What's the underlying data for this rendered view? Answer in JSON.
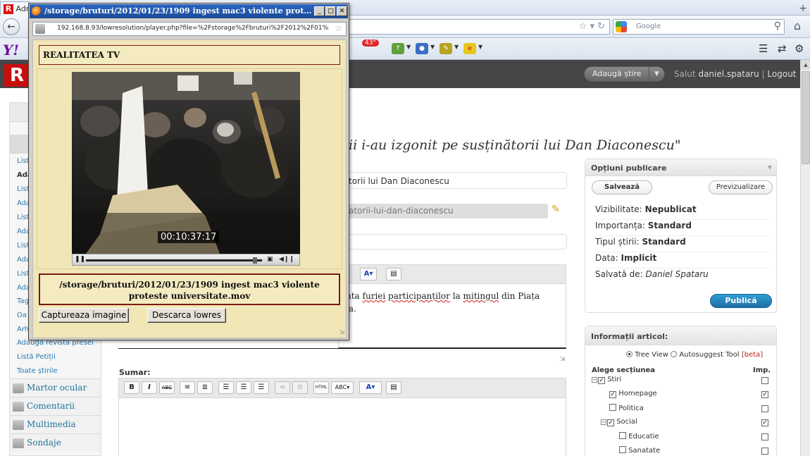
{
  "browser": {
    "tab_label": "Adm",
    "new_tab_icon": "plus-icon",
    "search_placeholder": "Google",
    "weather_badge": "43°"
  },
  "site": {
    "logo_letter": "R",
    "add_story_label": "Adaugă știre",
    "greeting_prefix": "Salut",
    "username": "daniel.spataru",
    "separator": "|",
    "logout_label": "Logout"
  },
  "sidebar": {
    "submenu": [
      "Listă",
      "Adaugă",
      "Listă",
      "Adaugă",
      "Listă",
      "Adaugă",
      "Listă",
      "Adaugă",
      "Listă",
      "Adaugă",
      "Tag",
      "Oa",
      "Arh",
      "Adaugă revista presei",
      "Listă Petiții",
      "Toate știrile"
    ],
    "groups": [
      "Martor ocular",
      "Comentarii",
      "Multimedia",
      "Sondaje"
    ]
  },
  "article": {
    "title_fragment": "ii i-au izgonit pe susținătorii lui Dan Diaconescu\"",
    "title_field_fragment": "torii lui Dan Diaconescu",
    "slug_fragment": "atorii-lui-dan-diaconescu",
    "content_line1_a": "nta ",
    "content_line1_b": "furiei",
    "content_line1_c": " ",
    "content_line1_d": "participanților",
    "content_line1_e": " la ",
    "content_line1_f": "mitingul",
    "content_line1_g": " din Piața",
    "content_line2": "ia."
  },
  "summary_label": "Sumar:",
  "publish_box": {
    "title": "Opțiuni publicare",
    "save_label": "Salvează",
    "preview_label": "Previzualizare",
    "rows": [
      {
        "label": "Vizibilitate:",
        "value": "Nepublicat"
      },
      {
        "label": "Importanța:",
        "value": "Standard"
      },
      {
        "label": "Tipul știrii:",
        "value": "Standard"
      },
      {
        "label": "Data:",
        "value": "Implicit"
      },
      {
        "label": "Salvată de:",
        "value": "Daniel Spataru"
      }
    ],
    "publish_label": "Publică"
  },
  "article_info": {
    "title": "Informații articol:",
    "tree_view_label": "Tree View",
    "autosuggest_label": "Autosuggest Tool",
    "beta_label": "[beta]",
    "section_header": "Alege secțiunea",
    "imp_header": "Imp.",
    "sections": [
      {
        "name": "Stiri",
        "checked": true,
        "imp": false
      },
      {
        "name": "Homepage",
        "checked": true,
        "imp": true
      },
      {
        "name": "Politica",
        "checked": false,
        "imp": false
      },
      {
        "name": "Social",
        "checked": true,
        "imp": true
      },
      {
        "name": "Educatie",
        "checked": false,
        "imp": false
      },
      {
        "name": "Sanatate",
        "checked": false,
        "imp": false
      }
    ]
  },
  "popup": {
    "title": "/storage/bruturi/2012/01/23/1909 ingest mac3 violente proteste univer...",
    "address": "192.168.8.93/lowresolution/player.php?file=%2Fstorage%2Fbruturi%2F2012%2F01%2F",
    "channel": "REALITATEA TV",
    "timecode": "00:10:37:17",
    "playback_progress": 0.97,
    "filename": "/storage/bruturi/2012/01/23/1909 ingest mac3 violente proteste universitate.mov",
    "capture_label": "Captureaza imagine",
    "download_label": "Descarca lowres"
  },
  "colors": {
    "accent_blue": "#21759b",
    "publish_blue": "#1e6fa6",
    "popup_bg": "#f0e6b6",
    "header_dark": "#464646",
    "logo_red": "#c90d0d"
  }
}
